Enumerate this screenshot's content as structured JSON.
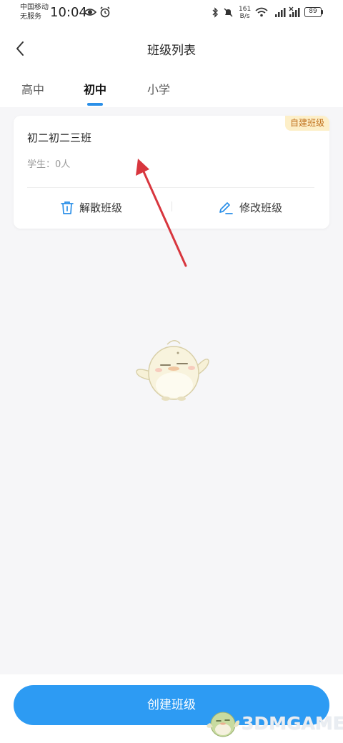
{
  "status_bar": {
    "carrier_line1": "中国移动",
    "carrier_line2": "无服务",
    "time": "10:04",
    "net_speed_value": "161",
    "net_speed_unit": "B/s",
    "network_type": "4G",
    "battery": "89"
  },
  "nav": {
    "back_icon": "chevron-left-icon",
    "title": "班级列表"
  },
  "tabs": [
    {
      "label": "高中",
      "active": false
    },
    {
      "label": "初中",
      "active": true
    },
    {
      "label": "小学",
      "active": false
    }
  ],
  "card": {
    "badge": "自建班级",
    "class_name": "初二初二三班",
    "students": "学生：0人",
    "actions": [
      {
        "label": "解散班级",
        "icon": "trash-icon"
      },
      {
        "label": "修改班级",
        "icon": "edit-icon"
      }
    ]
  },
  "create_button": "创建班级",
  "watermark": "3DMGAME",
  "colors": {
    "accent": "#2a8fe8",
    "button": "#2d9bf3",
    "badge_bg": "#fdefc8",
    "badge_text": "#c0701c",
    "annotation_arrow": "#d8363e",
    "background": "#f6f6f8"
  }
}
